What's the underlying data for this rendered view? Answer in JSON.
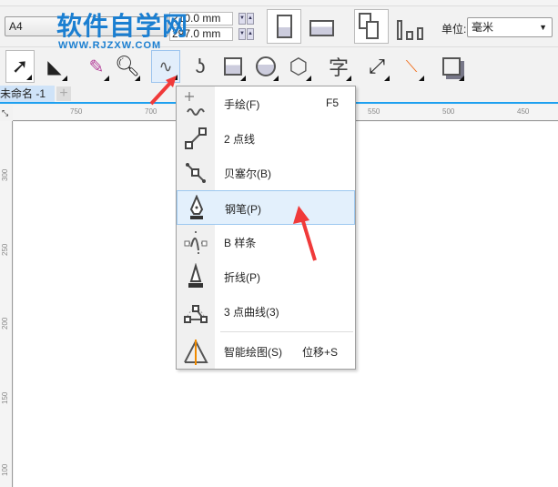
{
  "watermark": {
    "title": "软件自学网",
    "url": "WWW.RJZXW.COM"
  },
  "propbar": {
    "page_size": "A4",
    "width_value": "210.0 mm",
    "height_value": "297.0 mm",
    "unit_label": "单位:",
    "unit_value": "毫米"
  },
  "tab": {
    "label": "未命名 -1",
    "add": "+"
  },
  "ruler": {
    "h_labels": [
      "750",
      "700",
      "550",
      "500",
      "450"
    ],
    "v_labels": [
      "300",
      "250",
      "200",
      "150",
      "100"
    ]
  },
  "menu": {
    "items": [
      {
        "label": "手绘(F)",
        "shortcut": "F5",
        "icon": "freehand-icon"
      },
      {
        "label": "2 点线",
        "shortcut": "",
        "icon": "two-point-line-icon"
      },
      {
        "label": "贝塞尔(B)",
        "shortcut": "",
        "icon": "bezier-icon"
      },
      {
        "label": "钢笔(P)",
        "shortcut": "",
        "icon": "pen-icon",
        "highlighted": true
      },
      {
        "label": "B 样条",
        "shortcut": "",
        "icon": "b-spline-icon"
      },
      {
        "label": "折线(P)",
        "shortcut": "",
        "icon": "polyline-icon"
      },
      {
        "label": "3 点曲线(3)",
        "shortcut": "",
        "icon": "three-point-curve-icon"
      },
      {
        "label": "智能绘图(S)",
        "shortcut": "位移+S",
        "icon": "smart-drawing-icon"
      }
    ]
  },
  "colors": {
    "accent": "#1ea0f0",
    "highlight": "#e3f0fc",
    "arrow": "#f03a3a",
    "watermark": "#1b7fd1"
  }
}
